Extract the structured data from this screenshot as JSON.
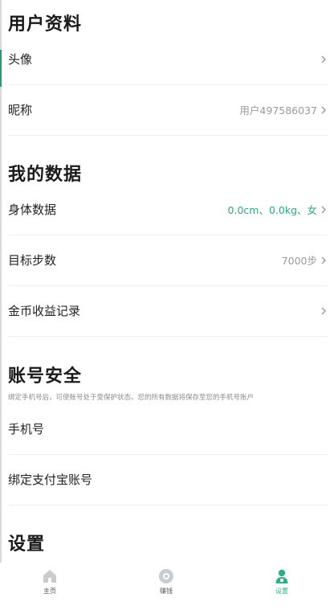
{
  "profile": {
    "title": "用户资料",
    "avatar_label": "头像",
    "nickname_label": "昵称",
    "nickname_value": "用户497586037"
  },
  "my_data": {
    "title": "我的数据",
    "body_label": "身体数据",
    "body_value": "0.0cm、0.0kg、女",
    "steps_label": "目标步数",
    "steps_value": "7000步",
    "coins_label": "金币收益记录"
  },
  "account": {
    "title": "账号安全",
    "description": "绑定手机号后，可使账号处于受保护状态。您的所有数据将保存至您的手机号账户",
    "phone_label": "手机号",
    "alipay_label": "绑定支付宝账号"
  },
  "settings": {
    "title": "设置"
  },
  "tabbar": {
    "home_label": "主页",
    "earn_label": "赚钱",
    "settings_label": "设置"
  },
  "colors": {
    "accent": "#2fb080",
    "value_green": "#2fa875",
    "tab_icon_inactive": "#c8ccd0"
  },
  "icons": {
    "home": "home-icon",
    "earn": "coin-icon",
    "settings": "user-settings-icon",
    "chevron": "chevron-right-icon"
  }
}
